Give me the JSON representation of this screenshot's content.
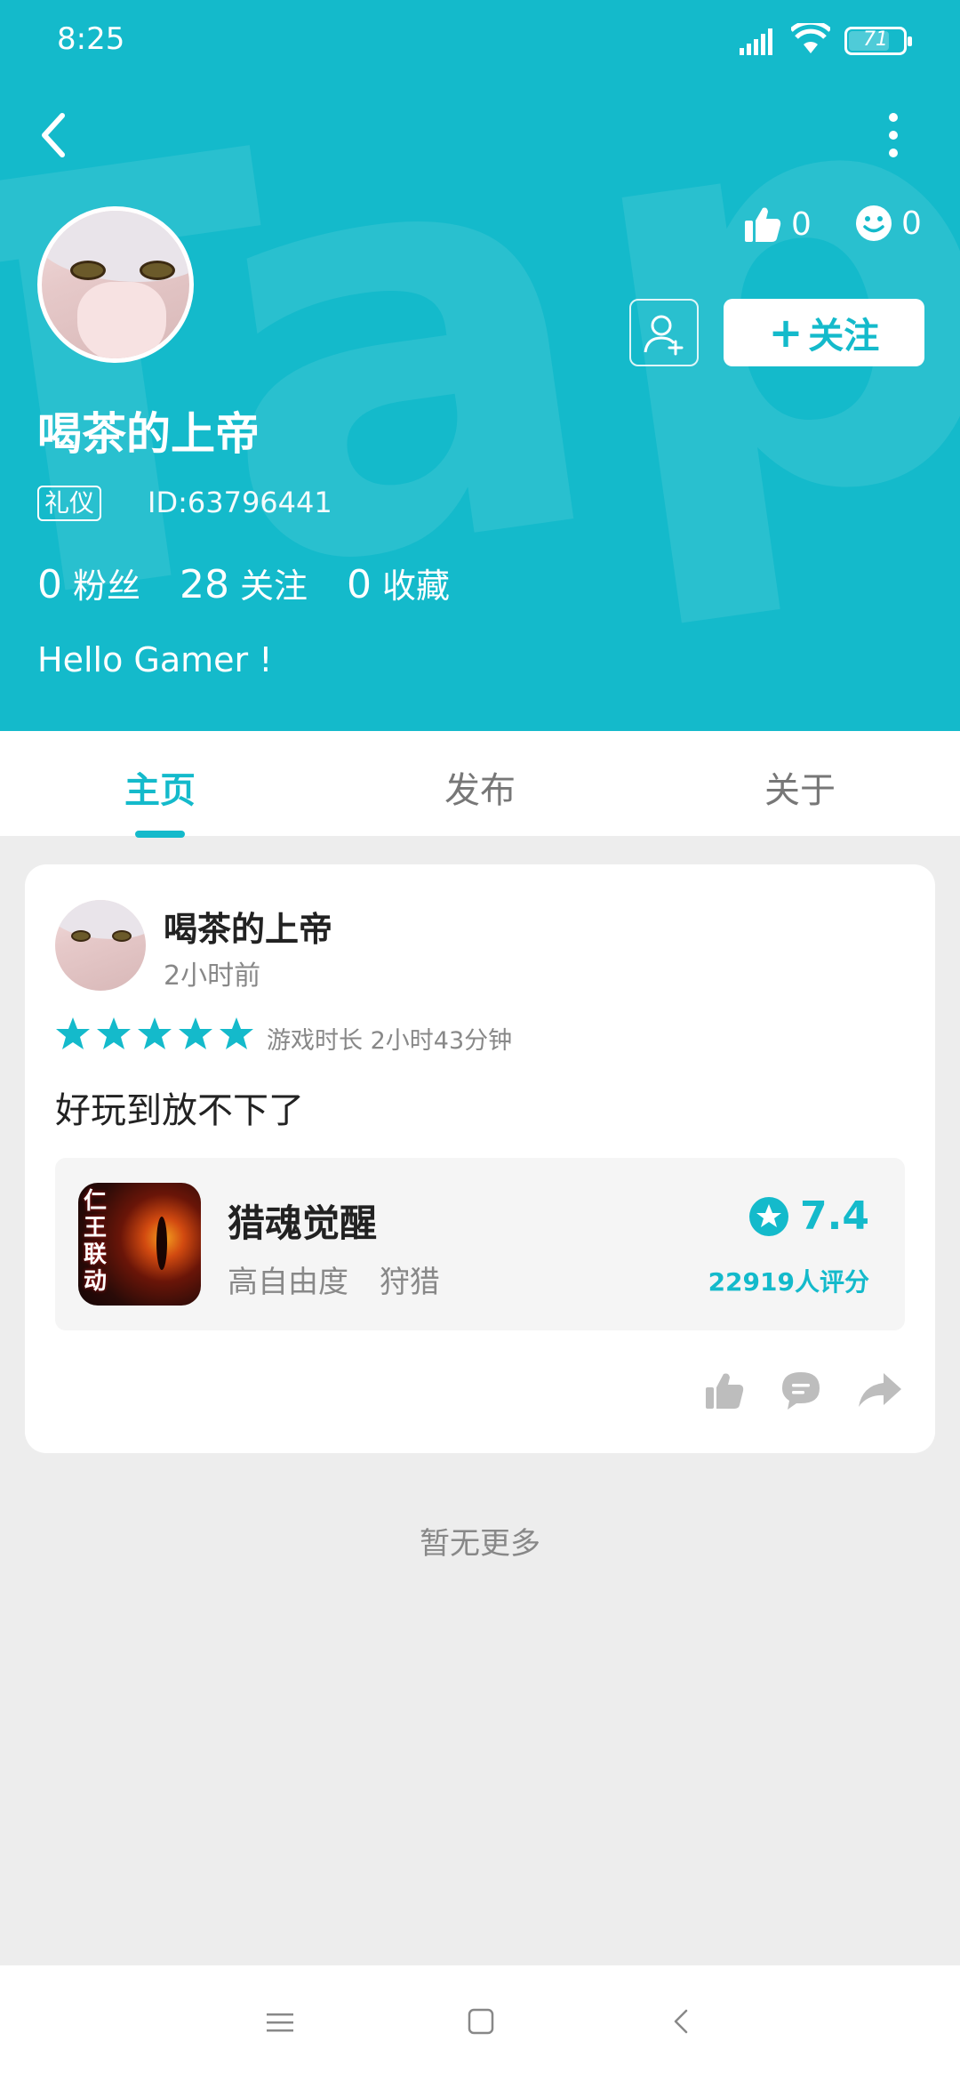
{
  "status_bar": {
    "time": "8:25",
    "battery": "71"
  },
  "profile": {
    "likes": "0",
    "reactions": "0",
    "follow_label": "关注",
    "follow_plus": "+",
    "username": "喝茶的上帝",
    "badge": "礼仪",
    "user_id": "ID:63796441",
    "stats": [
      {
        "count": "0",
        "label": "粉丝"
      },
      {
        "count": "28",
        "label": "关注"
      },
      {
        "count": "0",
        "label": "收藏"
      }
    ],
    "bio": "Hello Gamer !"
  },
  "tabs": [
    {
      "label": "主页",
      "active": true
    },
    {
      "label": "发布",
      "active": false
    },
    {
      "label": "关于",
      "active": false
    }
  ],
  "review": {
    "author": "喝茶的上帝",
    "time": "2小时前",
    "rating_stars": 5,
    "playtime": "游戏时长 2小时43分钟",
    "text": "好玩到放不下了",
    "game": {
      "icon_text": "仁王联动",
      "name": "猎魂觉醒",
      "tags": [
        "高自由度",
        "狩猎"
      ],
      "score": "7.4",
      "rating_count": "22919人评分"
    }
  },
  "footer": {
    "no_more": "暂无更多"
  },
  "colors": {
    "accent": "#14BACB",
    "background": "#EDEDED",
    "card": "#FFFFFF"
  },
  "icons": [
    "back-icon",
    "more-icon",
    "thumbs-up-icon",
    "smile-icon",
    "add-friend-icon",
    "star-icon",
    "like-icon",
    "comment-icon",
    "share-icon",
    "menu-icon",
    "home-icon",
    "nav-back-icon"
  ]
}
